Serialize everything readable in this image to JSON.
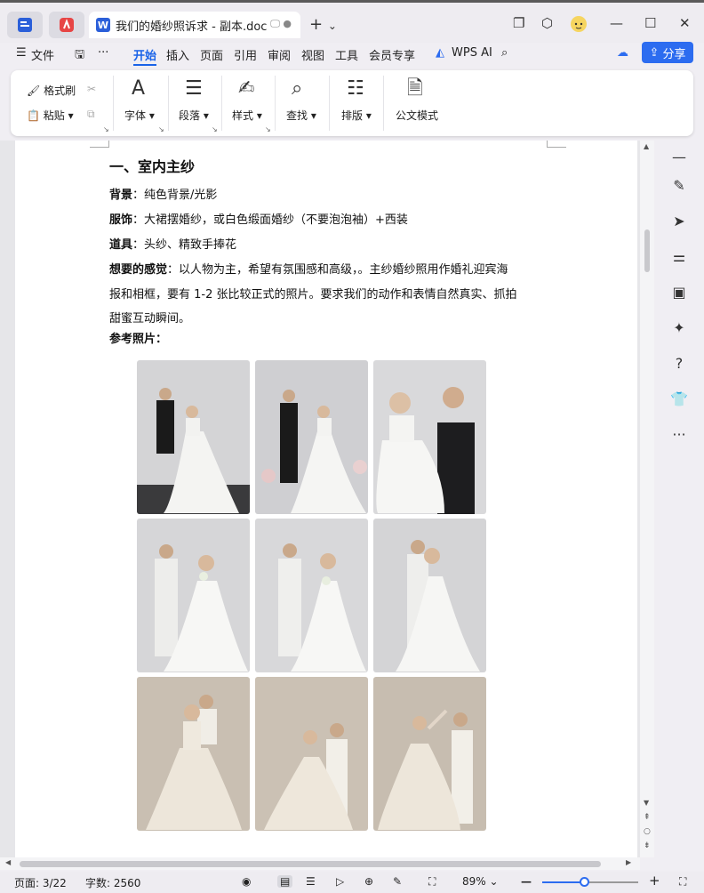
{
  "titlebar": {
    "doc_title": "我们的婚纱照诉求 - 副本.doc",
    "tab_icon_letter": "W",
    "add_tab": "+",
    "add_tab_chevron": "⌄"
  },
  "menu": {
    "items": [
      "文件",
      "开始",
      "插入",
      "页面",
      "引用",
      "审阅",
      "视图",
      "工具",
      "会员专享",
      "WPS AI"
    ],
    "active": "开始",
    "share": "分享"
  },
  "ribbon": {
    "format_painter": "格式刷",
    "paste": "粘贴",
    "font": "字体",
    "paragraph": "段落",
    "style": "样式",
    "find": "查找",
    "layout": "排版",
    "official_mode": "公文模式"
  },
  "document": {
    "heading": "一、室内主纱",
    "lines": [
      {
        "label": "背景",
        "sep": "：",
        "text": "纯色背景/光影"
      },
      {
        "label": "服饰",
        "sep": "：",
        "text": "大裙摆婚纱，或白色缎面婚纱（不要泡泡袖）+西装"
      },
      {
        "label": "道具",
        "sep": "：",
        "text": "头纱、精致手捧花"
      },
      {
        "label": "想要的感觉",
        "sep": "：",
        "text": "以人物为主，希望有氛围感和高级，。主纱婚纱照用作婚礼迎宾海"
      }
    ],
    "cont1": "报和相框，要有 1-2 张比较正式的照片。要求我们的动作和表情自然真实、抓拍",
    "cont2": "甜蜜互动瞬间。",
    "ref_label": "参考照片："
  },
  "status": {
    "page": "页面: 3/22",
    "words": "字数: 2560",
    "zoom": "89%",
    "zoom_level_fraction": 0.44
  },
  "colors": {
    "accent": "#1a63e8",
    "share_bg": "#2c6cf0"
  }
}
